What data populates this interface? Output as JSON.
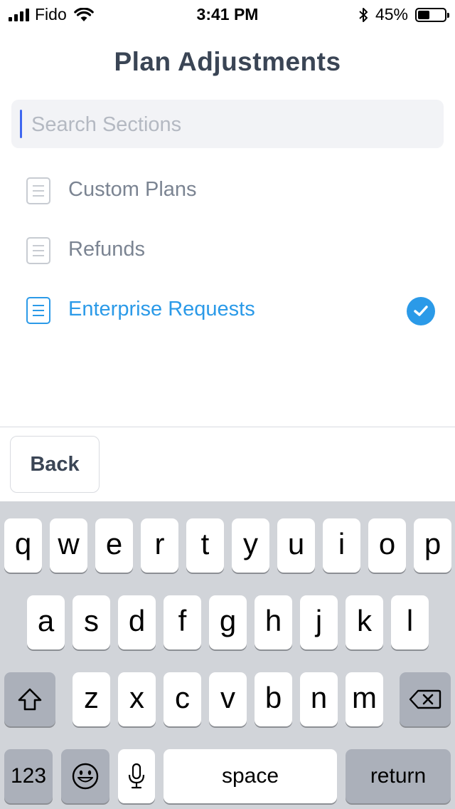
{
  "status_bar": {
    "carrier": "Fido",
    "time": "3:41 PM",
    "battery_percent": "45%",
    "battery_level": 0.45,
    "icons": [
      "cellular-signal-icon",
      "wifi-icon",
      "bluetooth-icon",
      "battery-icon"
    ]
  },
  "header": {
    "title": "Plan Adjustments"
  },
  "search": {
    "placeholder": "Search Sections",
    "value": ""
  },
  "sections": [
    {
      "label": "Custom Plans",
      "selected": false,
      "icon": "document-icon"
    },
    {
      "label": "Refunds",
      "selected": false,
      "icon": "document-icon"
    },
    {
      "label": "Enterprise Requests",
      "selected": true,
      "icon": "document-icon"
    }
  ],
  "footer": {
    "back_label": "Back"
  },
  "keyboard": {
    "row1": [
      "q",
      "w",
      "e",
      "r",
      "t",
      "y",
      "u",
      "i",
      "o",
      "p"
    ],
    "row2": [
      "a",
      "s",
      "d",
      "f",
      "g",
      "h",
      "j",
      "k",
      "l"
    ],
    "row3": [
      "z",
      "x",
      "c",
      "v",
      "b",
      "n",
      "m"
    ],
    "numbers_label": "123",
    "space_label": "space",
    "return_label": "return",
    "icons": [
      "shift-icon",
      "delete-icon",
      "emoji-icon",
      "microphone-icon"
    ]
  },
  "colors": {
    "accent": "#2b9ae8",
    "title": "#3a4555",
    "muted_text": "#7b8492",
    "search_bg": "#f2f3f6",
    "keyboard_bg": "#d1d4d9"
  }
}
